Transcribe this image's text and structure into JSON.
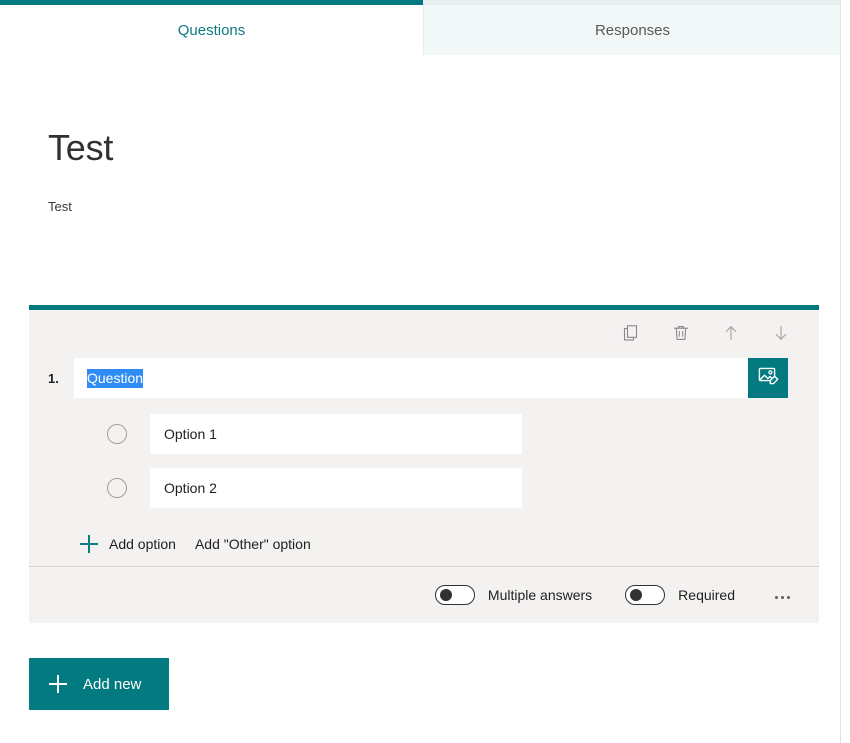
{
  "tabs": [
    {
      "label": "Questions",
      "active": true,
      "name": "tab-questions"
    },
    {
      "label": "Responses",
      "active": false,
      "name": "tab-responses"
    }
  ],
  "form": {
    "title": "Test",
    "description": "Test"
  },
  "question_card": {
    "accent_color": "#027a7f",
    "background": "#f3f2f1",
    "toolbar": [
      {
        "label": "Copy question",
        "icon": "copy-icon"
      },
      {
        "label": "Delete question",
        "icon": "trash-icon"
      },
      {
        "label": "Move question up",
        "icon": "arrow-up-icon"
      },
      {
        "label": "Move question down",
        "icon": "arrow-down-icon"
      }
    ],
    "number": "1.",
    "question_text": "Question",
    "question_placeholder": "Question",
    "question_text_selected": true,
    "insert_media_label": "Insert media",
    "options": [
      {
        "value": "Option 1",
        "placeholder": "Option 1",
        "selected": false
      },
      {
        "value": "Option 2",
        "placeholder": "Option 2",
        "selected": false
      }
    ],
    "add_option_label": "Add option",
    "add_other_option_label": "Add \"Other\" option",
    "toggles": [
      {
        "label": "Multiple answers",
        "on": false
      },
      {
        "label": "Required",
        "on": false
      }
    ],
    "more_options_label": "More settings for question"
  },
  "add_new": {
    "label": "Add new",
    "color": "#027a7f"
  },
  "colors": {
    "teal": "#027a7f",
    "teal_text": "#0f7a82",
    "card_bg": "#f3f2f1",
    "selection_blue": "#2f8cf4",
    "tab_inactive_bg": "#f2f8f8",
    "text_primary": "#201f1e",
    "icon_gray": "#8a8886"
  }
}
